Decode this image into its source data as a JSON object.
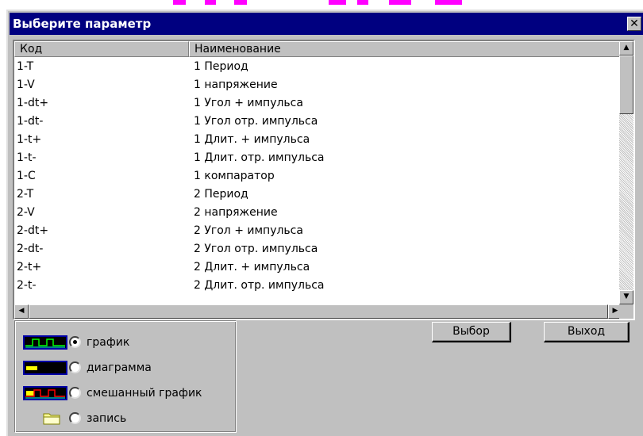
{
  "window": {
    "title": "Выберите параметр",
    "close_glyph": "✕"
  },
  "list": {
    "columns": [
      "Код",
      "Наименование"
    ],
    "rows": [
      {
        "code": "1-T",
        "name": "1 Период"
      },
      {
        "code": "1-V",
        "name": "1 напряжение"
      },
      {
        "code": "1-dt+",
        "name": "1 Угол + импульса"
      },
      {
        "code": "1-dt-",
        "name": "1 Угол отр. импульса"
      },
      {
        "code": "1-t+",
        "name": "1 Длит. + импульса"
      },
      {
        "code": "1-t-",
        "name": "1 Длит. отр. импульса"
      },
      {
        "code": "1-C",
        "name": "1 компаратор"
      },
      {
        "code": "2-T",
        "name": "2 Период"
      },
      {
        "code": "2-V",
        "name": "2 напряжение"
      },
      {
        "code": "2-dt+",
        "name": "2 Угол + импульса"
      },
      {
        "code": "2-dt-",
        "name": "2 Угол отр. импульса"
      },
      {
        "code": "2-t+",
        "name": "2 Длит. + импульса"
      },
      {
        "code": "2-t-",
        "name": "2 Длит. отр. импульса"
      }
    ]
  },
  "options": {
    "items": [
      {
        "label": "график",
        "icon": "graph-icon",
        "selected": true
      },
      {
        "label": "диаграмма",
        "icon": "diagram-icon",
        "selected": false
      },
      {
        "label": "смешанный график",
        "icon": "mixed-graph-icon",
        "selected": false
      },
      {
        "label": "запись",
        "icon": "folder-icon",
        "selected": false
      }
    ]
  },
  "buttons": {
    "select": "Выбор",
    "exit": "Выход"
  },
  "colors": {
    "titlebar": "#000080",
    "face": "#c0c0c0",
    "desktop_accent": "#ff00ff"
  }
}
